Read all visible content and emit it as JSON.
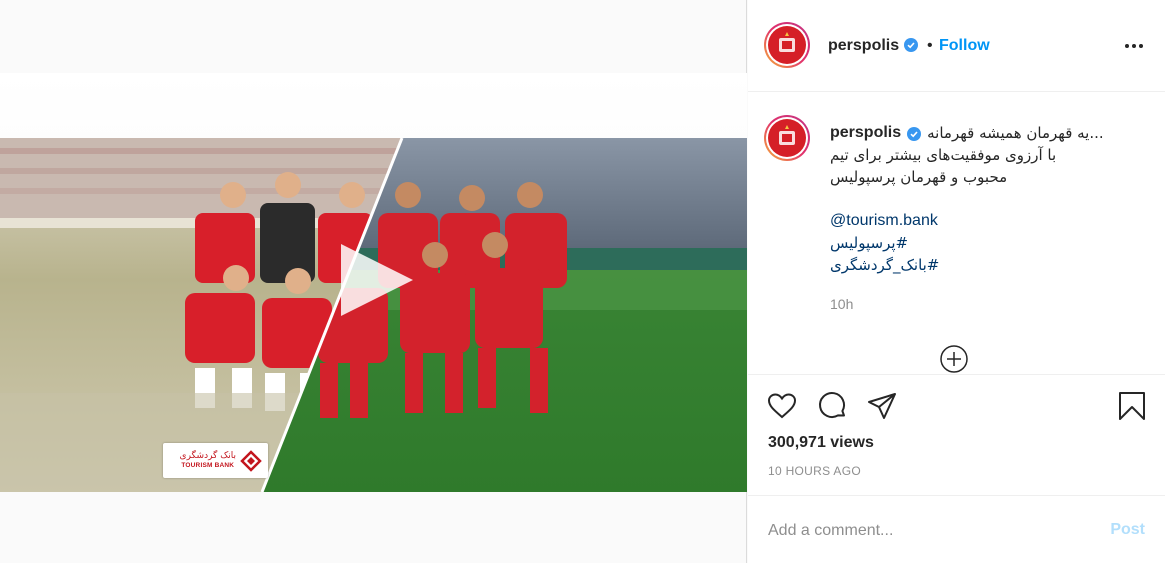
{
  "post": {
    "username": "perspolis",
    "follow_label": "Follow",
    "dot": "•",
    "caption": {
      "line1": "...یه قهرمان همیشه قهرمانه",
      "line2": "با آرزوی موفقیت‌های بیشتر برای تیم",
      "line3": "محبوب و قهرمان پرسپولیس",
      "mention": "@tourism.bank",
      "hashtag1": "#پرسپولیس",
      "hashtag2": "#بانک_گردشگری"
    },
    "time_relative": "10h",
    "views": "300,971 views",
    "time_ago": "10 HOURS AGO"
  },
  "media": {
    "bank_logo_fa": "بانک گردشگری",
    "bank_logo_en": "TOURISM BANK"
  },
  "comment": {
    "placeholder": "Add a comment...",
    "post_label": "Post"
  },
  "icons": {
    "verified": "verified-badge-icon",
    "more": "more-options-icon",
    "like": "heart-icon",
    "comment": "comment-icon",
    "share": "send-icon",
    "save": "bookmark-icon",
    "add": "add-circle-icon",
    "play": "play-icon"
  },
  "colors": {
    "accent": "#0095f6",
    "club_red": "#d51f27",
    "muted": "#8e8e8e"
  }
}
